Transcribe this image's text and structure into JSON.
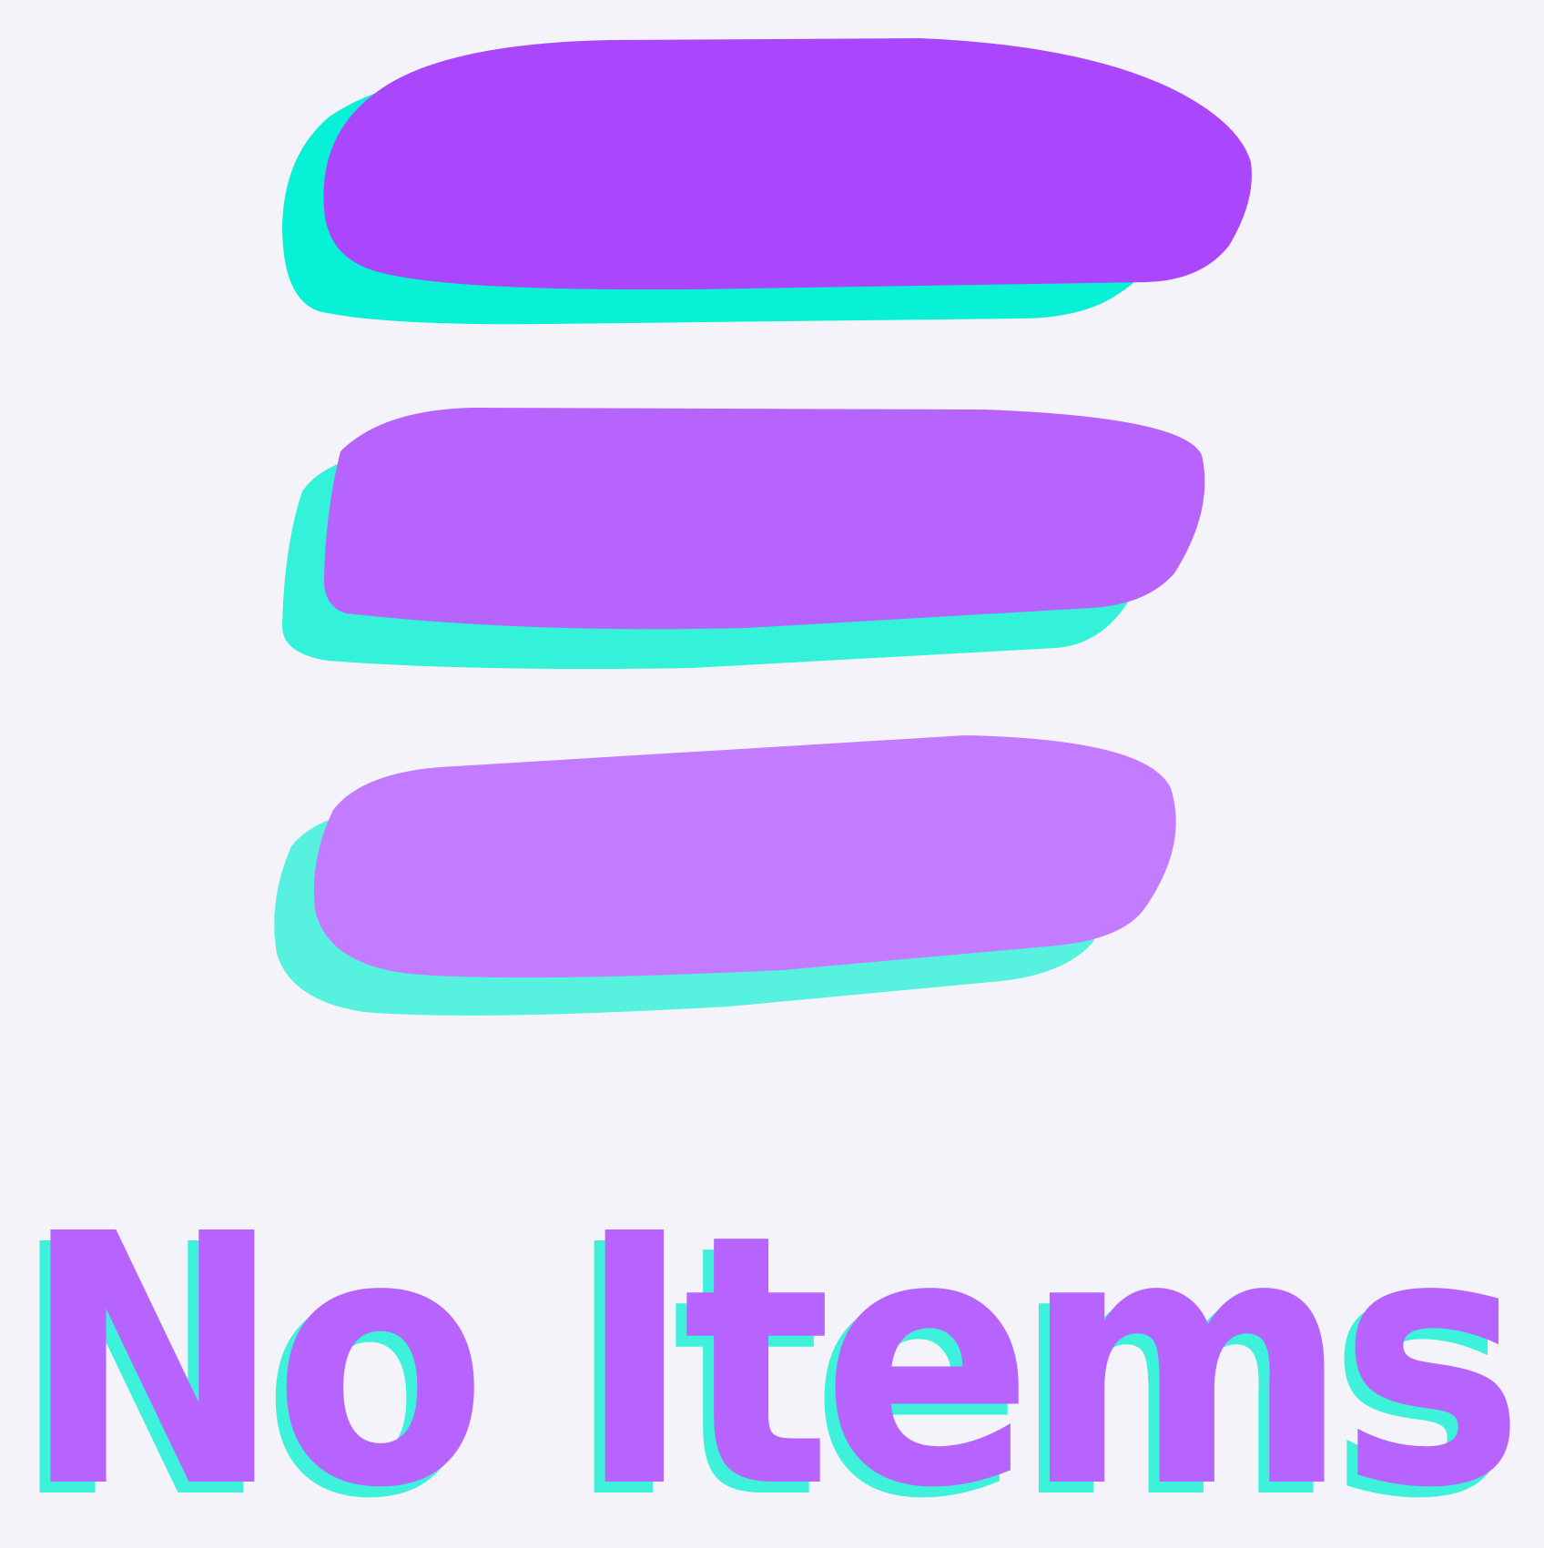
{
  "empty_state": {
    "title": "No Items",
    "illustration_icon": "list-placeholder-icon",
    "placeholder_bars": [
      {
        "fill": "#aa47fd",
        "shadow": "#08f0d5"
      },
      {
        "fill": "#b764fd",
        "shadow": "#34f1d9"
      },
      {
        "fill": "#c37cff",
        "shadow": "#56f1df"
      }
    ],
    "colors": {
      "background": "#f4f3f9",
      "title_fill": "#b763fd",
      "title_shadow": "#3ef1da"
    }
  }
}
